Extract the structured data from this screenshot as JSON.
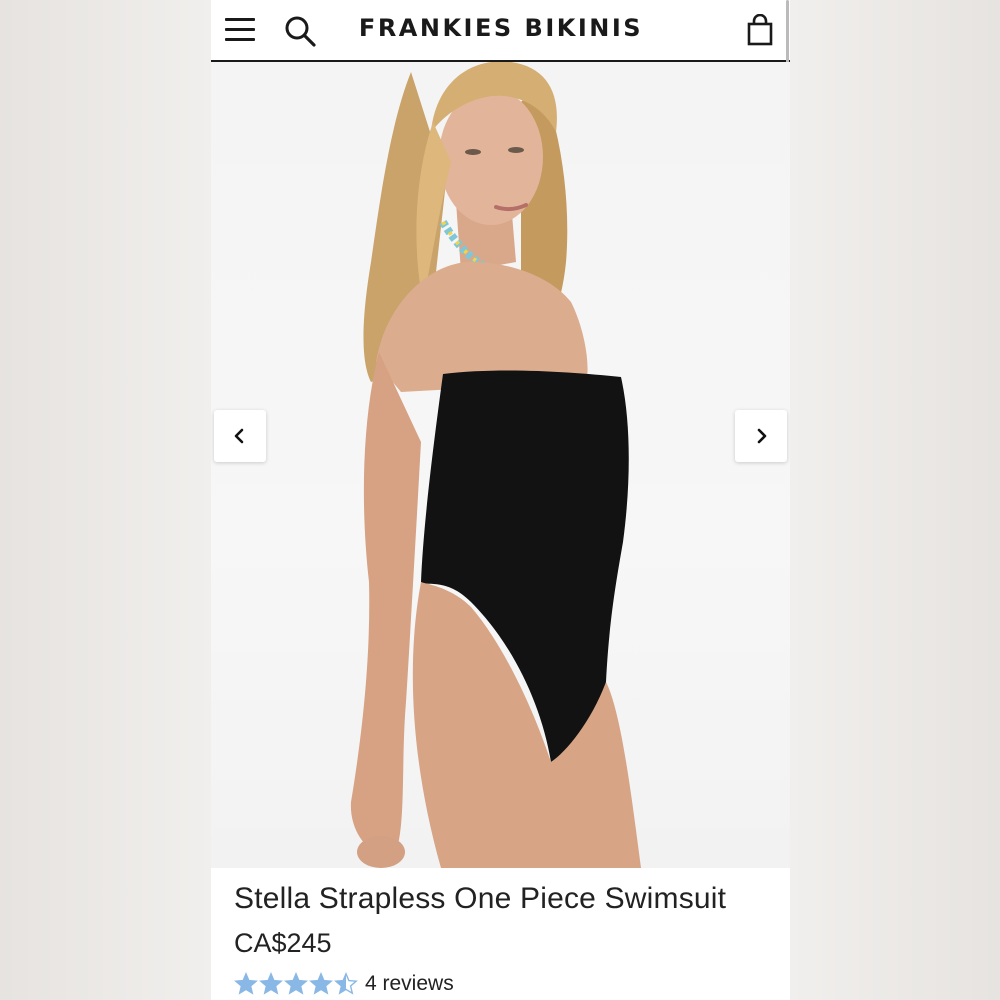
{
  "header": {
    "brand": "FRANKIES BIKINIS",
    "menu_icon": "hamburger-menu-icon",
    "search_icon": "search-icon",
    "cart_icon": "shopping-bag-icon"
  },
  "gallery": {
    "prev_icon": "chevron-left-icon",
    "next_icon": "chevron-right-icon"
  },
  "product": {
    "title": "Stella Strapless One Piece Swimsuit",
    "price": "CA$245",
    "rating": 4.5,
    "rating_max": 5,
    "reviews_label": "4 reviews"
  },
  "colors": {
    "star": "#8ab8e6",
    "text": "#222222",
    "header_border": "#1a1a1a"
  }
}
